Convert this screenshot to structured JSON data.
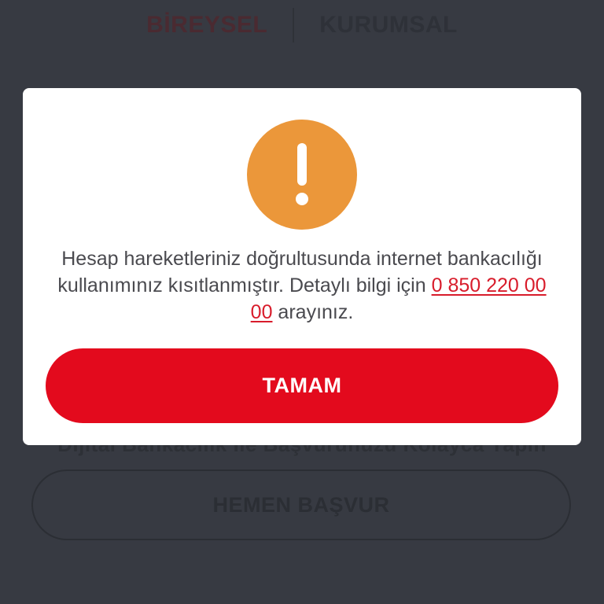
{
  "background": {
    "tabs": [
      {
        "label": "BİREYSEL"
      },
      {
        "label": "KURUMSAL"
      }
    ],
    "faded_text": "Dijital Bankacılık İle Başvurunuzu Kolayca Yapın",
    "apply_button_label": "HEMEN BAŞVUR"
  },
  "dialog": {
    "icon": "exclamation-warning-icon",
    "message_part1": "Hesap hareketleriniz doğrultusunda internet bankacılığı kullanımınız kısıtlanmıştır. Detaylı bilgi için ",
    "phone_number": "0 850 220 00 00",
    "message_part2": " arayınız.",
    "ok_button_label": "TAMAM"
  },
  "colors": {
    "overlay": "#373a42",
    "warning": "#eb973a",
    "primary_red": "#e30a1d",
    "link_red": "#d81c2b"
  }
}
